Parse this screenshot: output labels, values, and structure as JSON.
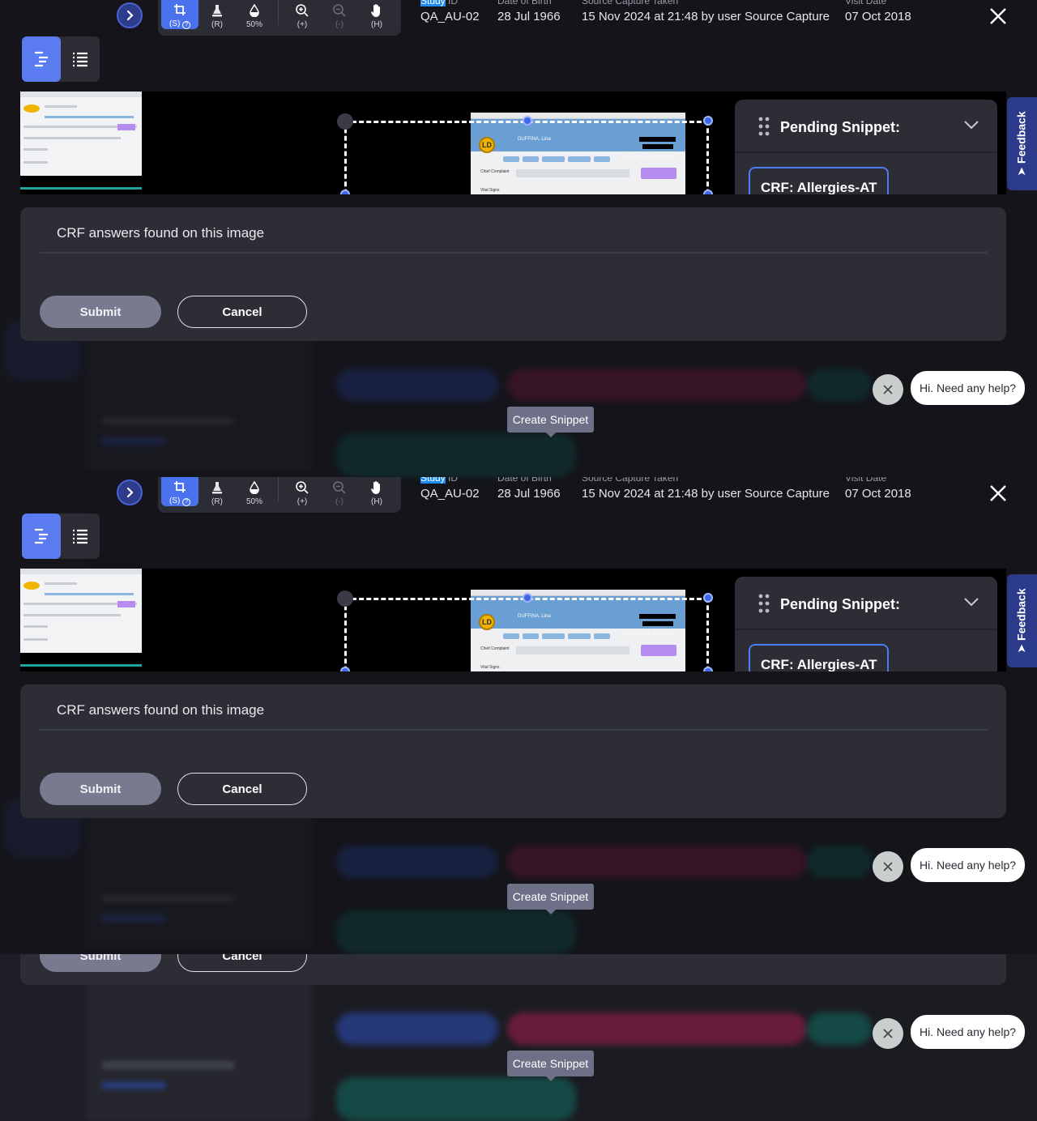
{
  "toolbar": {
    "tools": [
      {
        "label": "(S)",
        "icon": "crop-icon",
        "active": true
      },
      {
        "label": "(R)",
        "icon": "redact-icon"
      },
      {
        "label": "50%",
        "icon": "opacity-drop-icon"
      },
      {
        "label": "(+)",
        "icon": "zoom-in-icon"
      },
      {
        "label": "(-)",
        "icon": "zoom-out-icon",
        "disabled": true
      },
      {
        "label": "(H)",
        "icon": "hand-pan-icon"
      }
    ]
  },
  "meta": {
    "study_id_label_hl": "Study",
    "study_id_label_rest": " ID",
    "study_id": "QA_AU-02",
    "dob_label": "Date of Birth",
    "dob": "28 Jul 1966",
    "capture_label": "Source Capture Taken",
    "capture": "15 Nov 2024 at 21:48 by user Source Capture",
    "visit_label": "Visit Date",
    "visit": "07 Oct 2018"
  },
  "document": {
    "avatar": "LD",
    "patient_name": "DUFFINA, Lina",
    "service_date": "Date of Service: 10/23/2024",
    "chief_complaint": "Chief Complaint",
    "vital_signs": "Vital Signs"
  },
  "pending": {
    "title": "Pending Snippet:",
    "chip": "CRF: Allergies-AT"
  },
  "feedback": "Feedback",
  "crf": {
    "label": "CRF answers found on this image",
    "submit": "Submit",
    "cancel": "Cancel"
  },
  "tooltip": "Create Snippet",
  "help": "Hi. Need any help?",
  "colors": {
    "accent": "#4a72ef",
    "panel": "#2c2d35",
    "chip_border": "#4c7cf4",
    "submit_bg": "#797a90"
  }
}
